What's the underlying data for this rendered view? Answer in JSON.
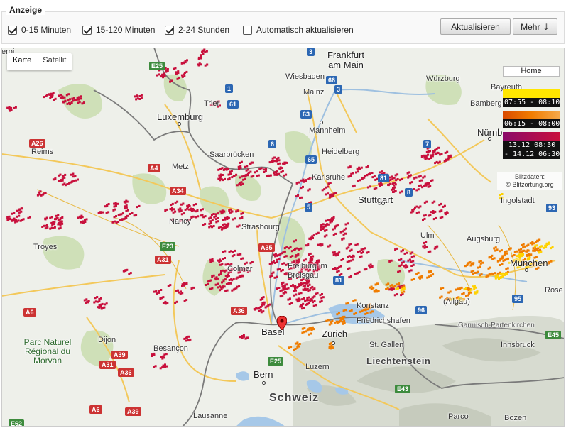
{
  "panel": {
    "title": "Anzeige",
    "options": [
      {
        "label": "0-15 Minuten",
        "checked": true
      },
      {
        "label": "15-120 Minuten",
        "checked": true
      },
      {
        "label": "2-24 Stunden",
        "checked": true
      },
      {
        "label": "Automatisch aktualisieren",
        "checked": false
      }
    ],
    "refresh_label": "Aktualisieren",
    "more_label": "Mehr ⇓"
  },
  "map_type": {
    "karte": "Karte",
    "satellit": "Satellit"
  },
  "home_label": "Home",
  "legend": [
    {
      "range": "07:55 - 08:10",
      "color": "#ffe600"
    },
    {
      "range": "06:15 - 08:00",
      "color": "#f07c00"
    },
    {
      "range": "13.12 08:30",
      "color": "#c8103c"
    },
    {
      "range": "- 14.12 06:30",
      "color": "#8a0a6a"
    }
  ],
  "credit": {
    "line1": "Blitzdaten:",
    "line2": "© Blitzortung.org"
  },
  "strike_colors": {
    "recent": "#ffd200",
    "mid": "#f07c00",
    "old": "#c8103c"
  },
  "places": {
    "frankfurt": "Frankfurt am Main",
    "wiesbaden": "Wiesbaden",
    "mainz": "Mainz",
    "wurzburg": "Würzburg",
    "bayreuth": "Bayreuth",
    "bamberg": "Bamberg",
    "nurnberg": "Nürnb",
    "trier": "Trier",
    "luxemburg": "Luxemburg",
    "mannheim": "Mannheim",
    "heidelberg": "Heidelberg",
    "saarbrucken": "Saarbrücken",
    "karlsruhe": "Karlsruhe",
    "reims": "Reims",
    "metz": "Metz",
    "stuttgart": "Stuttgart",
    "ingolstadt": "Ingolstadt",
    "nancy": "Nancy",
    "strasbourg": "Strasbourg",
    "ulm": "Ulm",
    "augsburg": "Augsburg",
    "troyes": "Troyes",
    "colmar": "Colmar",
    "freiburg": "Freiburg im Breisgau",
    "munchen": "München",
    "rosenheim": "Rose",
    "konstanz": "Konstanz",
    "allgau": "(Allgäu)",
    "friedrichshafen": "Friedrichshafen",
    "garmisch": "Garmisch-Partenkirchen",
    "basel": "Basel",
    "zurich": "Zürich",
    "dijon": "Dijon",
    "stgallen": "St. Gallen",
    "innsbruck": "Innsbruck",
    "liechtenstein": "Liechtenstein",
    "besancon": "Besançon",
    "bern": "Bern",
    "luzern": "Luzern",
    "schweiz": "Schweiz",
    "lausanne": "Lausanne",
    "bolzano": "Bozen",
    "parco": "Parco",
    "morvan": "Parc Naturel Régional du Morvan",
    "eroi": "eroi"
  },
  "roads": {
    "e25": "E25",
    "a26": "A26",
    "a4": "A4",
    "a34": "A34",
    "e23": "E23",
    "a31": "A31",
    "a35": "A35",
    "a36": "A36",
    "a6": "A6",
    "a39": "A39",
    "e25b": "E25",
    "a31b": "A31",
    "a36b": "A36",
    "a6b": "A6",
    "a39b": "A39",
    "e62": "E62",
    "e43": "E43",
    "e45": "E45",
    "n3": "3",
    "n1": "1",
    "n66": "66",
    "n3b": "3",
    "n61": "61",
    "n63": "63",
    "n6": "6",
    "n65": "65",
    "n81": "81",
    "n8": "8",
    "n5": "5",
    "n81b": "81",
    "n96": "96",
    "n95": "95",
    "n93": "93",
    "n1b": "1",
    "n7": "7"
  }
}
